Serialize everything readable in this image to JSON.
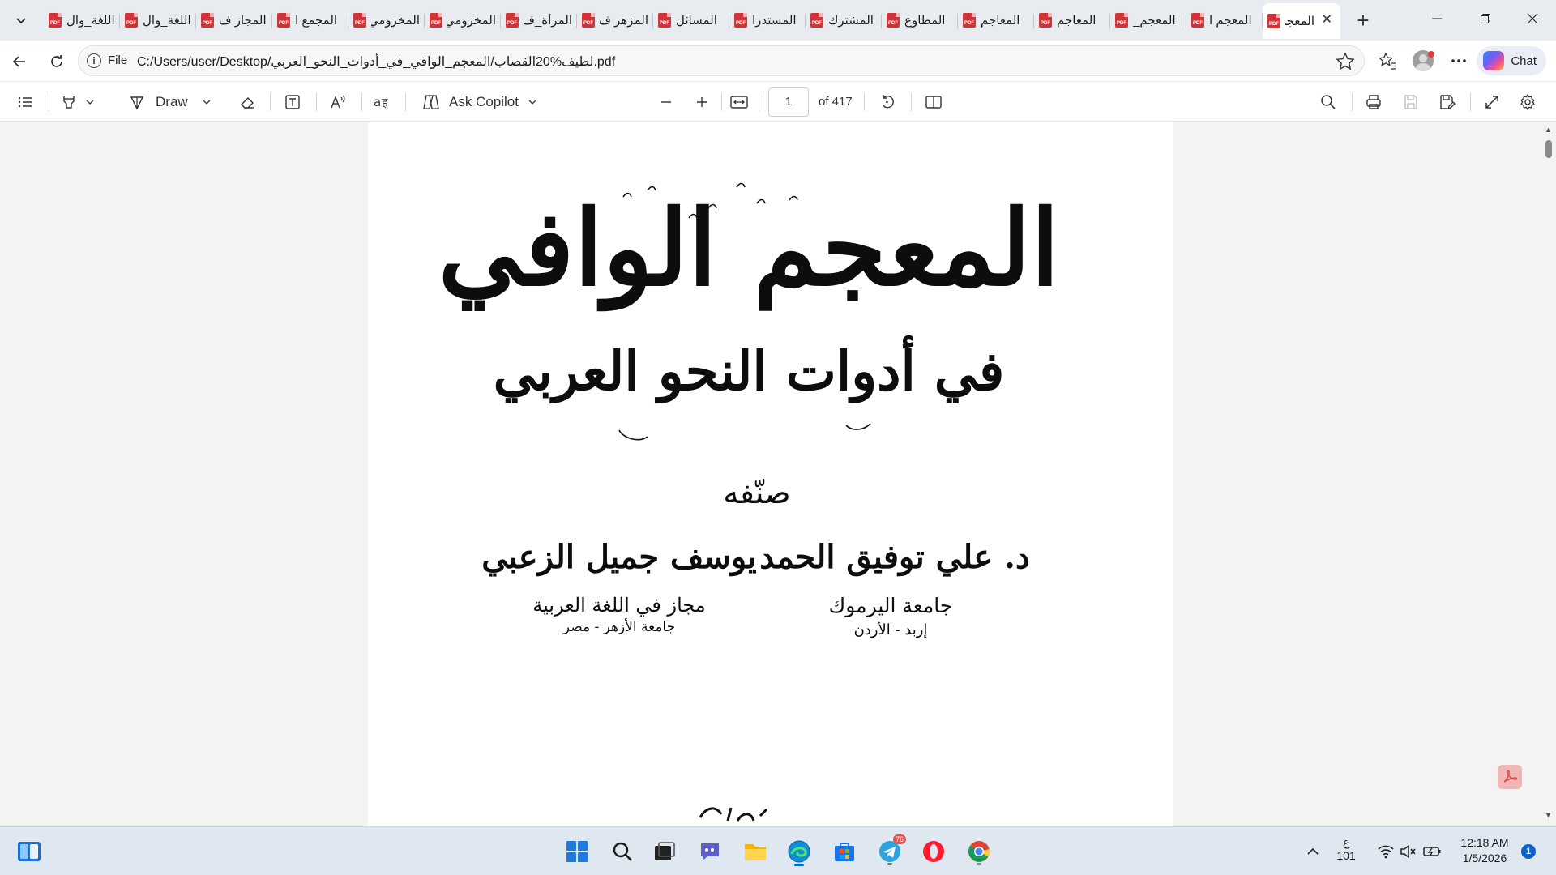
{
  "browser": {
    "tab_menu_icon": "chevron-down-icon",
    "tabs": [
      {
        "title": "اللغة_وال"
      },
      {
        "title": "اللغة_وال"
      },
      {
        "title": "المجاز ف"
      },
      {
        "title": "المجمع ا"
      },
      {
        "title": "المخزومي"
      },
      {
        "title": "المخزومي"
      },
      {
        "title": "المرأة_ف"
      },
      {
        "title": "المزهر ف"
      },
      {
        "title": "المسائل"
      },
      {
        "title": "المستدرا"
      },
      {
        "title": "المشترك"
      },
      {
        "title": "المطاوع"
      },
      {
        "title": "المعاجم"
      },
      {
        "title": "المعاجم"
      },
      {
        "title": "المعجم_"
      },
      {
        "title": "المعجم ا"
      }
    ],
    "active_tab": {
      "title": "المعجم"
    },
    "new_tab_icon": "plus-icon",
    "address": {
      "scheme_label": "File",
      "url": "C:/Users/user/Desktop/لطيف%20القصاب/المعجم_الواقي_في_أدوات_النحو_العربي.pdf"
    },
    "chat_label": "Chat"
  },
  "pdf_toolbar": {
    "draw_label": "Draw",
    "copilot_label": "Ask Copilot",
    "page_number": "1",
    "page_of": "of 417"
  },
  "document": {
    "title_main": "المعجم الوافي",
    "title_sub": "في أدوات النحو العربي",
    "compiled_by": "صنّفه",
    "author1": {
      "name": "د. علي توفيق الحمد",
      "affiliation": "جامعة اليرموك",
      "location": "إربد - الأردن"
    },
    "author2": {
      "name": "يوسف جميل الزعبي",
      "affiliation": "مجاز في اللغة العربية",
      "location": "جامعة الأزهر - مصر"
    }
  },
  "taskbar": {
    "lang_line1": "ع",
    "lang_line2": "101",
    "time": "12:18 AM",
    "date": "1/5/2026",
    "notification_count": "1",
    "telegram_badge": "76"
  },
  "colors": {
    "accent": "#0a64c8",
    "pdf_red": "#d13438",
    "tab_strip": "#e8ebef",
    "taskbar": "#dfe7f1"
  }
}
